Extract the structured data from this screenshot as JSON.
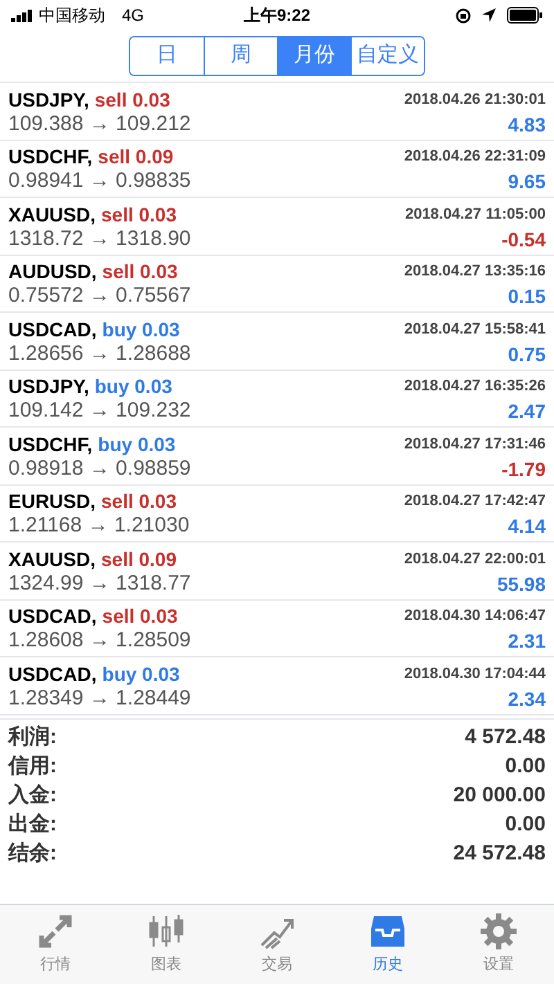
{
  "status_bar": {
    "carrier": "中国移动",
    "network": "4G",
    "time": "上午9:22"
  },
  "period_tabs": [
    {
      "label": "日",
      "selected": false
    },
    {
      "label": "周",
      "selected": false
    },
    {
      "label": "月份",
      "selected": true
    },
    {
      "label": "自定义",
      "selected": false
    }
  ],
  "trades": [
    {
      "symbol": "USDJPY,",
      "kind": "sell",
      "type": "sell 0.03",
      "prices": "109.388 → 109.212",
      "time": "2018.04.26 21:30:01",
      "profit": "4.83",
      "loss": false
    },
    {
      "symbol": "USDCHF,",
      "kind": "sell",
      "type": "sell 0.09",
      "prices": "0.98941 → 0.98835",
      "time": "2018.04.26 22:31:09",
      "profit": "9.65",
      "loss": false
    },
    {
      "symbol": "XAUUSD,",
      "kind": "sell",
      "type": "sell 0.03",
      "prices": "1318.72 → 1318.90",
      "time": "2018.04.27 11:05:00",
      "profit": "-0.54",
      "loss": true
    },
    {
      "symbol": "AUDUSD,",
      "kind": "sell",
      "type": "sell 0.03",
      "prices": "0.75572 → 0.75567",
      "time": "2018.04.27 13:35:16",
      "profit": "0.15",
      "loss": false
    },
    {
      "symbol": "USDCAD,",
      "kind": "buy",
      "type": "buy 0.03",
      "prices": "1.28656 → 1.28688",
      "time": "2018.04.27 15:58:41",
      "profit": "0.75",
      "loss": false
    },
    {
      "symbol": "USDJPY,",
      "kind": "buy",
      "type": "buy 0.03",
      "prices": "109.142 → 109.232",
      "time": "2018.04.27 16:35:26",
      "profit": "2.47",
      "loss": false
    },
    {
      "symbol": "USDCHF,",
      "kind": "buy",
      "type": "buy 0.03",
      "prices": "0.98918 → 0.98859",
      "time": "2018.04.27 17:31:46",
      "profit": "-1.79",
      "loss": true
    },
    {
      "symbol": "EURUSD,",
      "kind": "sell",
      "type": "sell 0.03",
      "prices": "1.21168 → 1.21030",
      "time": "2018.04.27 17:42:47",
      "profit": "4.14",
      "loss": false
    },
    {
      "symbol": "XAUUSD,",
      "kind": "sell",
      "type": "sell 0.09",
      "prices": "1324.99 → 1318.77",
      "time": "2018.04.27 22:00:01",
      "profit": "55.98",
      "loss": false
    },
    {
      "symbol": "USDCAD,",
      "kind": "sell",
      "type": "sell 0.03",
      "prices": "1.28608 → 1.28509",
      "time": "2018.04.30 14:06:47",
      "profit": "2.31",
      "loss": false
    },
    {
      "symbol": "USDCAD,",
      "kind": "buy",
      "type": "buy 0.03",
      "prices": "1.28349 → 1.28449",
      "time": "2018.04.30 17:04:44",
      "profit": "2.34",
      "loss": false
    }
  ],
  "summary": [
    {
      "label": "利润:",
      "value": "4 572.48"
    },
    {
      "label": "信用:",
      "value": "0.00"
    },
    {
      "label": "入金:",
      "value": "20 000.00"
    },
    {
      "label": "出金:",
      "value": "0.00"
    },
    {
      "label": "结余:",
      "value": "24 572.48"
    }
  ],
  "bottom_tabs": [
    {
      "kind": "quotes",
      "label": "行情",
      "selected": false
    },
    {
      "kind": "chart",
      "label": "图表",
      "selected": false
    },
    {
      "kind": "trade",
      "label": "交易",
      "selected": false
    },
    {
      "kind": "history",
      "label": "历史",
      "selected": true
    },
    {
      "kind": "settings",
      "label": "设置",
      "selected": false
    }
  ]
}
